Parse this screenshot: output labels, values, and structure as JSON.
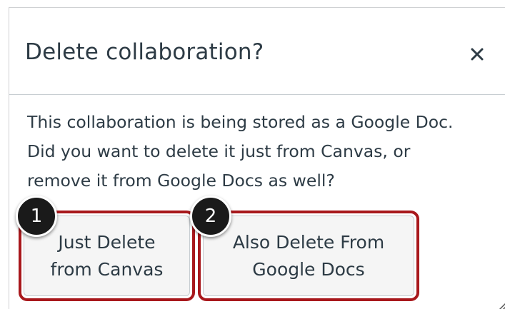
{
  "dialog": {
    "title": "Delete collaboration?",
    "close_icon": "close-icon",
    "body_lines": [
      "This collaboration is being stored as a Google Doc.",
      "Did you want to delete it just from Canvas, or",
      "remove it from Google Docs as well?"
    ],
    "buttons": [
      {
        "line1": "Just Delete",
        "line2": "from Canvas"
      },
      {
        "line1": "Also Delete From",
        "line2": "Google Docs"
      }
    ]
  },
  "annotations": {
    "badges": [
      "1",
      "2"
    ],
    "highlight_color": "#a8181c"
  },
  "colors": {
    "text": "#2d3b45",
    "divider": "#c7cdd1",
    "button_bg": "#f5f5f5"
  }
}
